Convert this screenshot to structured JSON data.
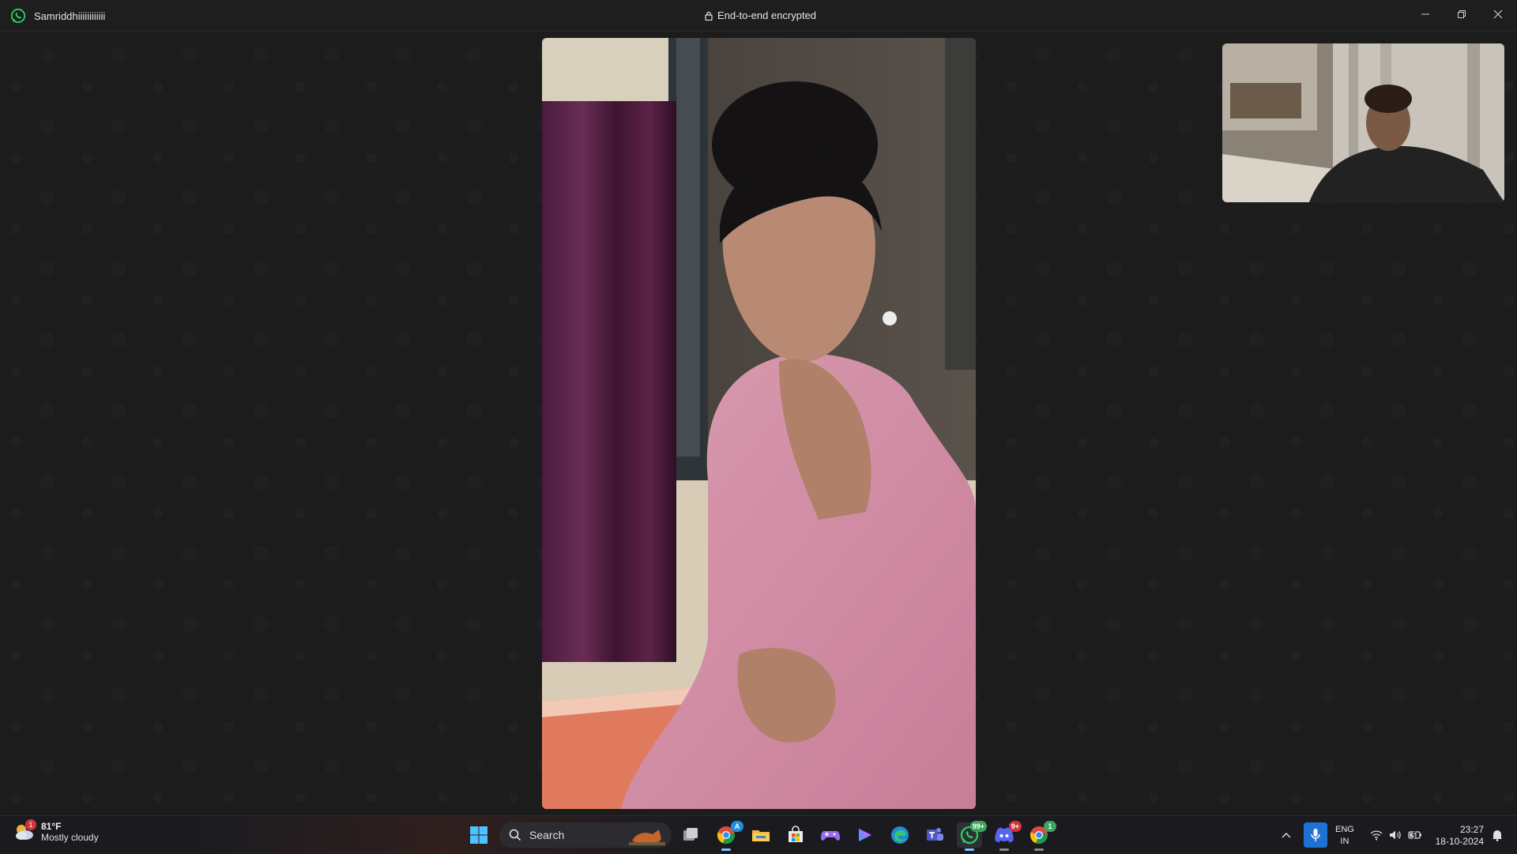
{
  "titlebar": {
    "contact_name": "Samriddhiiiiiiiiiiii",
    "encryption_label": "End-to-end encrypted",
    "accent": "#25d366"
  },
  "call": {
    "remote_video": "remote participant camera feed",
    "self_video": "local camera preview"
  },
  "taskbar": {
    "weather": {
      "temp": "81°F",
      "desc": "Mostly cloudy",
      "badge": "1"
    },
    "search_label": "Search",
    "apps": [
      {
        "name": "start-icon"
      },
      {
        "name": "task-view-icon"
      },
      {
        "name": "chrome-icon"
      },
      {
        "name": "file-explorer-icon"
      },
      {
        "name": "microsoft-store-icon"
      },
      {
        "name": "game-controller-icon"
      },
      {
        "name": "copilot-icon"
      },
      {
        "name": "edge-icon"
      },
      {
        "name": "teams-icon"
      },
      {
        "name": "whatsapp-icon",
        "badge": "99+"
      },
      {
        "name": "discord-icon",
        "badge": "9+"
      },
      {
        "name": "chrome-profile-icon",
        "badge": "1"
      }
    ],
    "tray": {
      "lang_primary": "ENG",
      "lang_secondary": "IN",
      "time": "23:27",
      "date": "18-10-2024"
    }
  }
}
